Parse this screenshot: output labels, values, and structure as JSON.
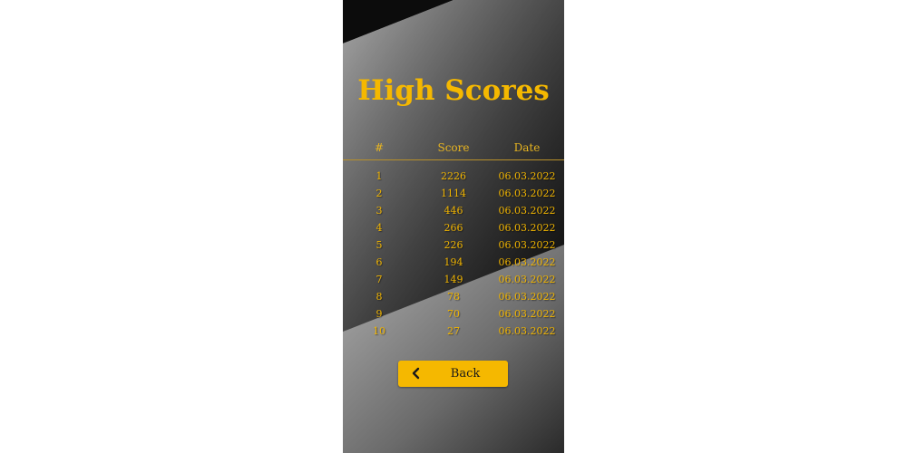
{
  "screen": {
    "title": "High Scores",
    "accent_color": "#f5b800"
  },
  "table": {
    "headers": {
      "index": "#",
      "score": "Score",
      "date": "Date"
    },
    "rows": [
      {
        "rank": "1",
        "score": "2226",
        "date": "06.03.2022"
      },
      {
        "rank": "2",
        "score": "1114",
        "date": "06.03.2022"
      },
      {
        "rank": "3",
        "score": "446",
        "date": "06.03.2022"
      },
      {
        "rank": "4",
        "score": "266",
        "date": "06.03.2022"
      },
      {
        "rank": "5",
        "score": "226",
        "date": "06.03.2022"
      },
      {
        "rank": "6",
        "score": "194",
        "date": "06.03.2022"
      },
      {
        "rank": "7",
        "score": "149",
        "date": "06.03.2022"
      },
      {
        "rank": "8",
        "score": "78",
        "date": "06.03.2022"
      },
      {
        "rank": "9",
        "score": "70",
        "date": "06.03.2022"
      },
      {
        "rank": "10",
        "score": "27",
        "date": "06.03.2022"
      }
    ]
  },
  "back_button": {
    "label": "Back",
    "icon": "chevron-left-icon"
  }
}
